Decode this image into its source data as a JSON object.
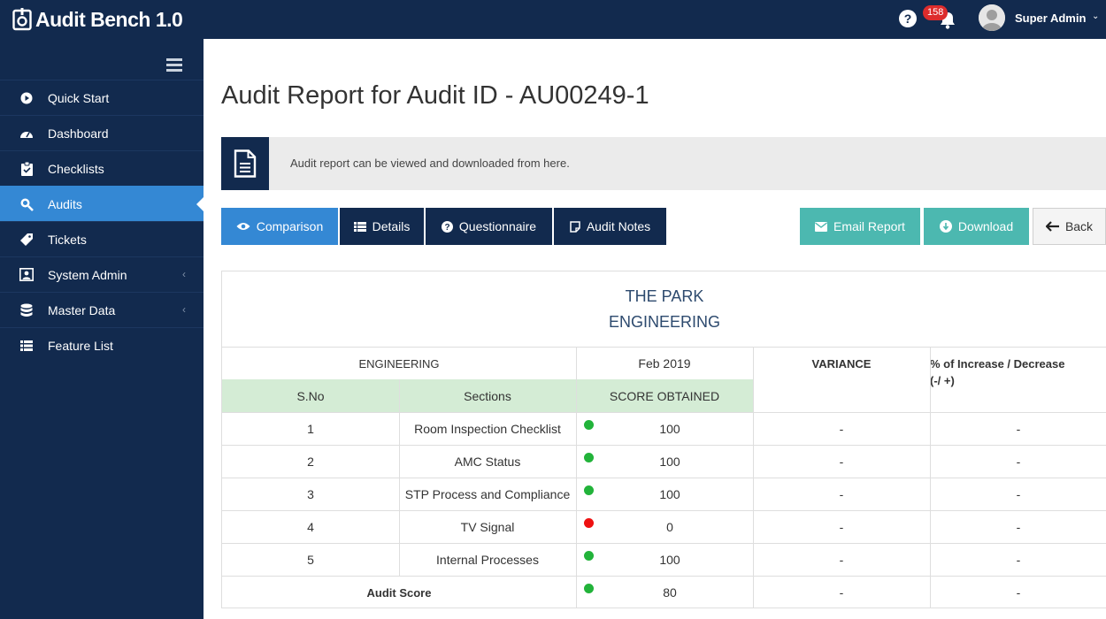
{
  "app": {
    "title": "Audit Bench 1.0"
  },
  "header": {
    "notification_count": "158",
    "user_name": "Super Admin",
    "help_glyph": "?"
  },
  "sidebar": {
    "items": [
      {
        "label": "Quick Start",
        "icon": "play-circle-icon"
      },
      {
        "label": "Dashboard",
        "icon": "dashboard-gauge-icon"
      },
      {
        "label": "Checklists",
        "icon": "clipboard-icon"
      },
      {
        "label": "Audits",
        "icon": "search-audit-icon",
        "active": true
      },
      {
        "label": "Tickets",
        "icon": "ticket-icon"
      },
      {
        "label": "System Admin",
        "icon": "user-admin-icon",
        "has_submenu": true
      },
      {
        "label": "Master Data",
        "icon": "database-icon",
        "has_submenu": true
      },
      {
        "label": "Feature List",
        "icon": "list-icon"
      }
    ]
  },
  "main": {
    "title": "Audit Report for Audit ID - AU00249-1",
    "info_text": "Audit report can be viewed and downloaded from here.",
    "tabs": {
      "comparison": "Comparison",
      "details": "Details",
      "questionnaire": "Questionnaire",
      "audit_notes": "Audit Notes"
    },
    "actions": {
      "email_report": "Email Report",
      "download": "Download",
      "back": "Back"
    }
  },
  "report": {
    "property": "THE PARK",
    "department": "ENGINEERING",
    "group_header": "ENGINEERING",
    "period": "Feb 2019",
    "variance_header": "VARIANCE",
    "pct_header": "% of Increase / Decrease",
    "pct_header_sub": "(-/ +)",
    "col_sno": "S.No",
    "col_sections": "Sections",
    "col_score": "SCORE OBTAINED",
    "rows": [
      {
        "sno": "1",
        "section": "Room Inspection Checklist",
        "score": "100",
        "status": "green",
        "variance": "-",
        "pct": "-"
      },
      {
        "sno": "2",
        "section": "AMC Status",
        "score": "100",
        "status": "green",
        "variance": "-",
        "pct": "-"
      },
      {
        "sno": "3",
        "section": "STP Process and Compliance",
        "score": "100",
        "status": "green",
        "variance": "-",
        "pct": "-"
      },
      {
        "sno": "4",
        "section": "TV Signal",
        "score": "0",
        "status": "red",
        "variance": "-",
        "pct": "-"
      },
      {
        "sno": "5",
        "section": "Internal Processes",
        "score": "100",
        "status": "green",
        "variance": "-",
        "pct": "-"
      }
    ],
    "total": {
      "label": "Audit Score",
      "score": "80",
      "status": "green",
      "variance": "-",
      "pct": "-"
    }
  },
  "colors": {
    "navy": "#122a4e",
    "accent_blue": "#3488d4",
    "teal": "#4cb8b0",
    "green_status": "#22b33a",
    "red_status": "#ee1111"
  }
}
